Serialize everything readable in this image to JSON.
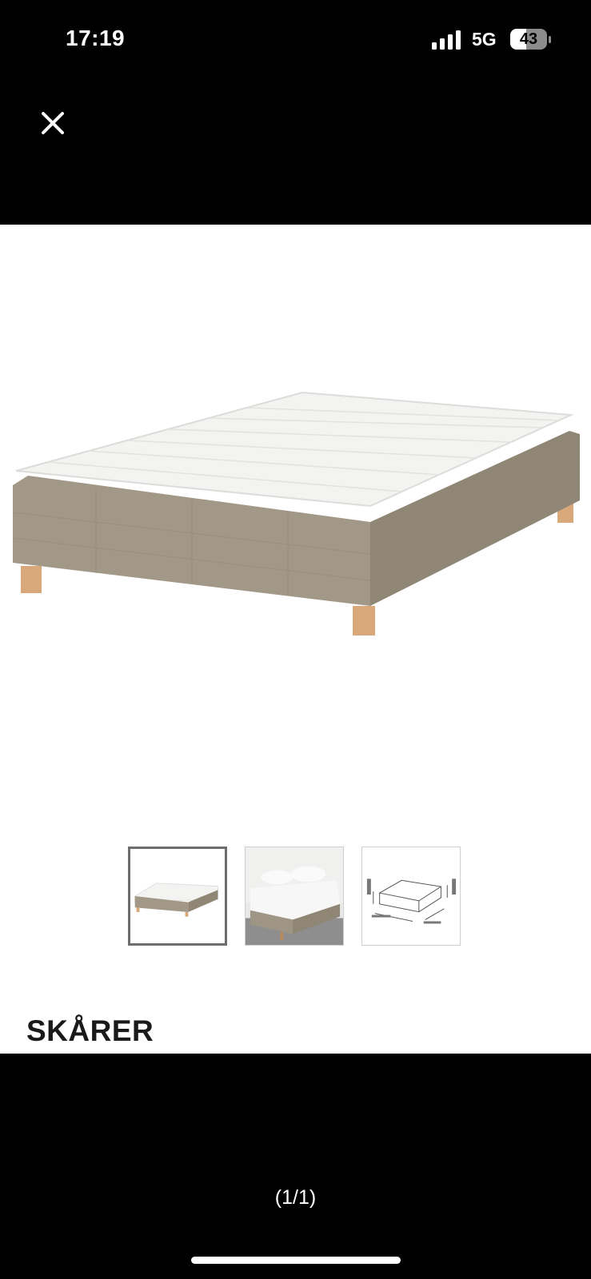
{
  "status_bar": {
    "time": "17:19",
    "network": "5G",
    "battery_level": "43",
    "battery_fraction": 0.43
  },
  "icons": {
    "close": "close-icon",
    "signal": "cellular-signal-icon",
    "battery": "battery-icon"
  },
  "product": {
    "name": "SKÅRER"
  },
  "gallery": {
    "counter": "(1/1)",
    "selected_index": 0,
    "thumbnails": [
      {
        "depicts": "bed-base-front-view"
      },
      {
        "depicts": "bed-in-bedroom"
      },
      {
        "depicts": "dimension-drawing"
      }
    ]
  },
  "colors": {
    "chrome_background": "#000000",
    "panel_background": "#ffffff",
    "fabric": "#9f9585",
    "mattress_topper": "#f3f3f1",
    "legs": "#d8a77a"
  }
}
